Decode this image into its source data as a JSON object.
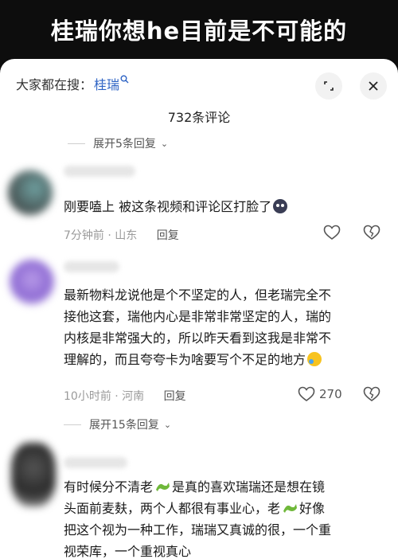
{
  "banner": {
    "title": "桂瑞你想he目前是不可能的"
  },
  "search": {
    "prefix": "大家都在搜：",
    "term": "桂瑞"
  },
  "comments_count": "732条评论",
  "expand_top": "展开5条回复",
  "comments": [
    {
      "text": "刚要嗑上 被这条视频和评论区打脸了",
      "time": "7分钟前 · 山东",
      "reply": "回复",
      "likes": ""
    },
    {
      "lines": [
        "最新物料龙说他是个不坚定的人，但老瑞完全不",
        "接他这套，瑞他内心是非常非常坚定的人，瑞的",
        "内核是非常强大的，所以昨天看到这我是非常不",
        "理解的，而且夸夸卡为啥要写个不足的地方"
      ],
      "time": "10小时前 · 河南",
      "reply": "回复",
      "likes": "270",
      "expand": "展开15条回复"
    },
    {
      "line1_a": "有时候分不清老",
      "line1_b": "是真的喜欢瑞瑞还是想在镜",
      "line2_a": "头面前麦麸，两个人都很有事业心，老",
      "line2_b": "好像",
      "line3": "把这个视为一种工作，瑞瑞又真诚的很，一个重",
      "line4": "视荣库，一个重视真心"
    }
  ],
  "colors": {
    "accent": "#2d63c4",
    "dragon": "#6fb83a"
  },
  "icons": [
    "search-icon",
    "expand-icon",
    "close-icon",
    "heart-icon",
    "broken-heart-icon",
    "chevron-down-icon",
    "dragon-emoji",
    "cry-emoji",
    "face-emoji"
  ]
}
